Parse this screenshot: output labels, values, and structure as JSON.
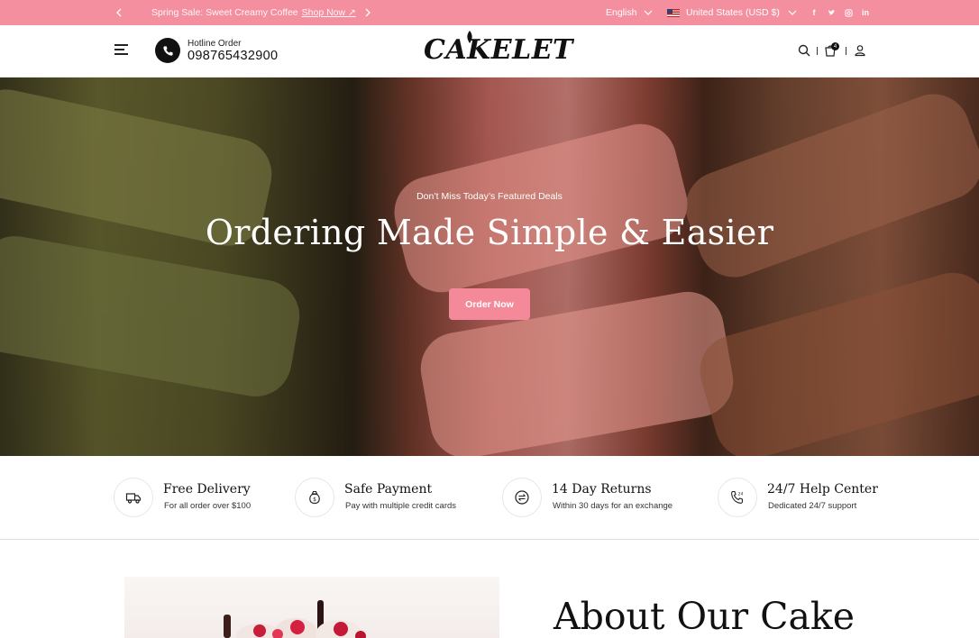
{
  "announcement": {
    "promo_text": "Spring Sale: Sweet Creamy Coffee",
    "promo_link": "Shop Now ↗",
    "language": "English",
    "currency": "United States (USD $)",
    "prev_icon": "chevron-left-icon",
    "next_icon": "chevron-right-icon",
    "socials": [
      "facebook-icon",
      "twitter-icon",
      "instagram-icon",
      "linkedin-icon"
    ],
    "bg_color": "#f48fa0"
  },
  "header": {
    "hotline_label": "Hotline Order",
    "hotline_number": "098765432900",
    "logo": "CAKELET",
    "cart_count": "4"
  },
  "hero": {
    "subtitle": "Don’t Miss Today’s Featured Deals",
    "title": "Ordering Made Simple & Easier",
    "button": "Order Now",
    "accent_color": "#f4899a"
  },
  "features": [
    {
      "icon": "delivery-truck-icon",
      "title": "Free Delivery",
      "desc": "For all order over $100"
    },
    {
      "icon": "money-bag-icon",
      "title": "Safe Payment",
      "desc": "Pay with multiple credit cards"
    },
    {
      "icon": "return-arrow-icon",
      "title": "14 Day Returns",
      "desc": "Within 30 days for an exchange"
    },
    {
      "icon": "phone-24-icon",
      "title": "24/7 Help Center",
      "desc": "Dedicated 24/7 support"
    }
  ],
  "about": {
    "title": "About Our Cake"
  }
}
